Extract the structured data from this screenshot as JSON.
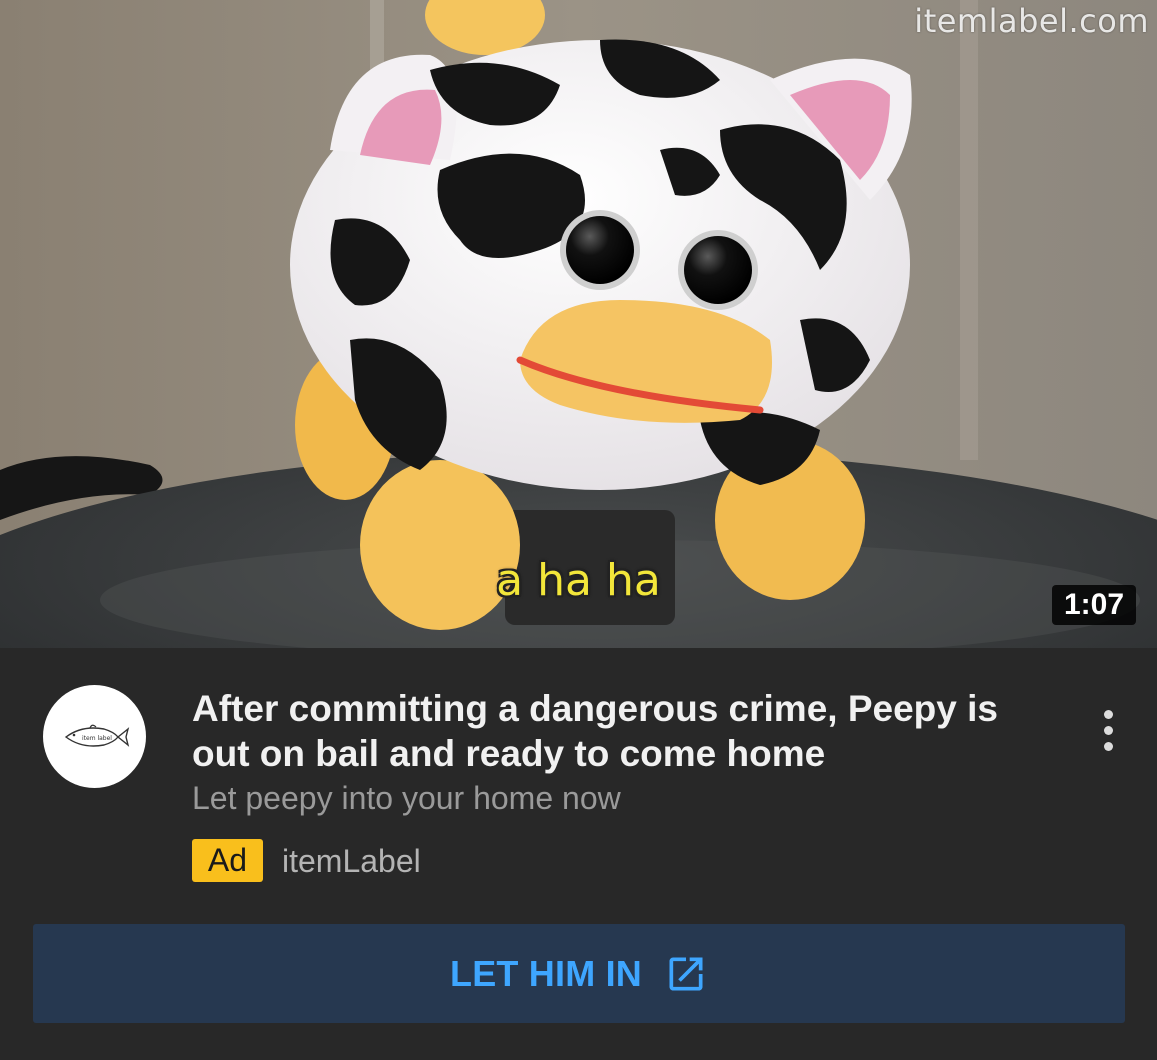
{
  "thumbnail": {
    "watermark": "itemlabel.com",
    "caption": "a ha ha",
    "duration": "1:07"
  },
  "ad": {
    "avatar_logo_text": "item label",
    "title": "After committing a dangerous crime, Peepy is out on bail and ready to come home",
    "subtitle": "Let peepy into your home now",
    "badge": "Ad",
    "advertiser": "itemLabel"
  },
  "cta": {
    "label": "LET HIM IN",
    "icon": "open-in-new-icon"
  },
  "menu": {
    "icon": "more-vert-icon"
  },
  "colors": {
    "background": "#282828",
    "ad_badge": "#f9bf1c",
    "cta_background": "#263850",
    "cta_text": "#3ea6ff",
    "caption": "#f2e63a"
  }
}
